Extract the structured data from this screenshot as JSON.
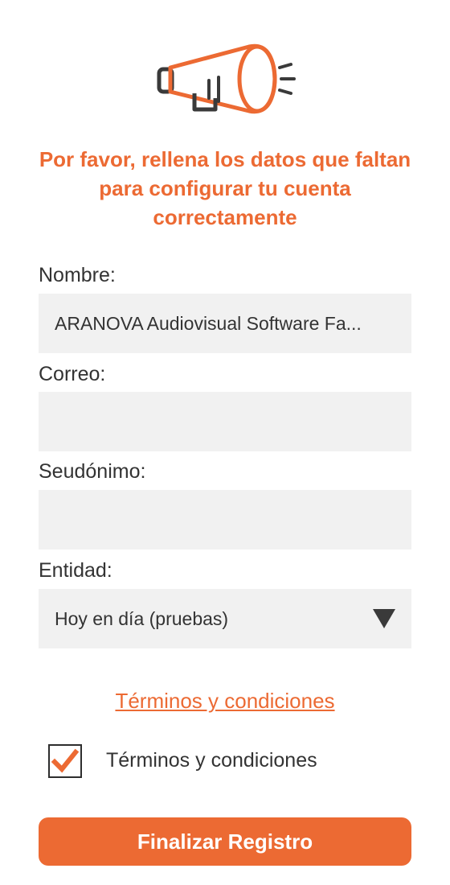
{
  "header": {
    "logo_icon": "megaphone-icon",
    "message": "Por favor, rellena los datos que faltan para configurar tu cuenta correctamente"
  },
  "form": {
    "name": {
      "label": "Nombre:",
      "value": "ARANOVA Audiovisual Software Fa..."
    },
    "email": {
      "label": "Correo:",
      "value": ""
    },
    "alias": {
      "label": "Seudónimo:",
      "value": ""
    },
    "entity": {
      "label": "Entidad:",
      "value": "Hoy en día (pruebas)",
      "icon": "dropdown-triangle-icon"
    }
  },
  "terms": {
    "link_text": "Términos y condiciones",
    "checkbox_label": "Términos y condiciones",
    "checked": true
  },
  "submit": {
    "label": "Finalizar Registro"
  },
  "colors": {
    "accent": "#EC6A33",
    "field_bg": "#F1F1F1",
    "text": "#333333"
  }
}
